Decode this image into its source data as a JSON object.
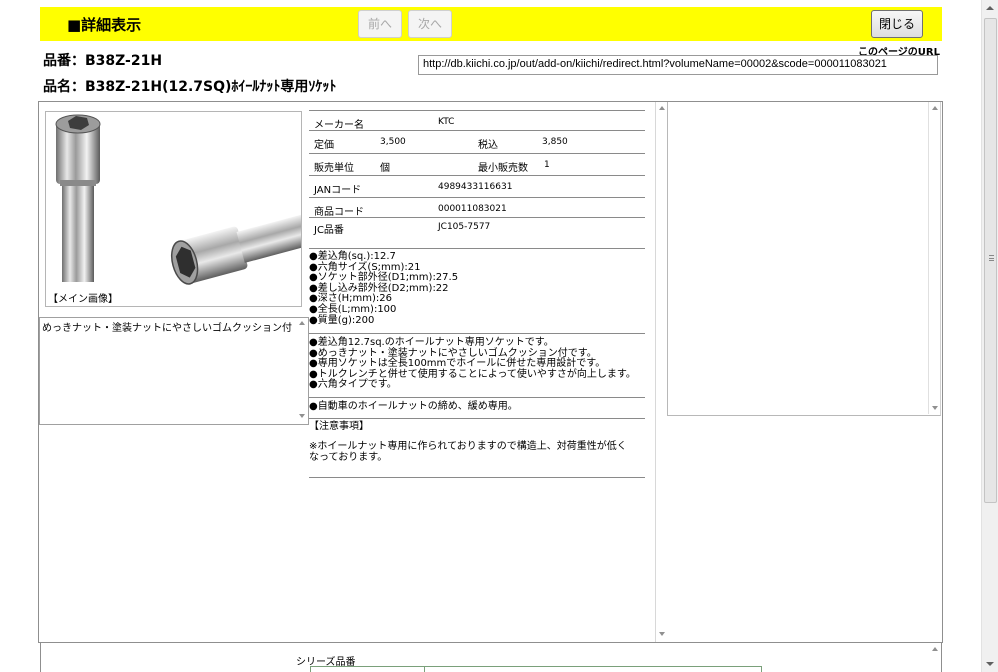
{
  "header": {
    "title": "■詳細表示",
    "prev_label": "前へ",
    "next_label": "次へ",
    "close_label": "閉じる"
  },
  "product": {
    "number": "品番：B38Z-21H",
    "name": "品名：B38Z-21H(12.7SQ)ﾎｲｰﾙﾅｯﾄ専用ｿｹｯﾄ"
  },
  "url": {
    "label": "このページのURL",
    "value": "http://db.kiichi.co.jp/out/add-on/kiichi/redirect.html?volumeName=00002&scode=000011083021"
  },
  "photo": {
    "caption": "【メイン画像】"
  },
  "description": {
    "text": "めっきナット・塗装ナットにやさしいゴムクッション付"
  },
  "spec": {
    "maker_label": "メーカー名",
    "maker": "KTC",
    "price_label": "定価",
    "price": "3,500",
    "tax_label": "税込",
    "tax_price": "3,850",
    "unit_label": "販売単位",
    "unit": "個",
    "min_label": "最小販売数",
    "min": "1",
    "jan_label": "JANコード",
    "jan": "4989433116631",
    "code_label": "商品コード",
    "code": "000011083021",
    "jc_label": "JC品番",
    "jc": "JC105-7577"
  },
  "specs_list": [
    "●差込角(sq.):12.7",
    "●六角サイズ(S;mm):21",
    "●ソケット部外径(D1;mm):27.5",
    "●差し込み部外径(D2;mm):22",
    "●深さ(H;mm):26",
    "●全長(L;mm):100",
    "●質量(g):200"
  ],
  "features": [
    "●差込角12.7sq.のホイールナット専用ソケットです。",
    "●めっきナット・塗装ナットにやさしいゴムクッション付です。",
    "●専用ソケットは全長100mmでホイールに併せた専用設計です。",
    "●トルクレンチと併せて使用することによって使いやすさが向上します。",
    "●六角タイプです。"
  ],
  "usage": "●自動車のホイールナットの締め、緩め専用。",
  "notes": {
    "heading": "【注意事項】",
    "line1": "※ホイールナット専用に作られておりますので構造上、対荷重性が低く",
    "line2": "なっております。"
  },
  "series": {
    "label": "シリーズ品番"
  }
}
